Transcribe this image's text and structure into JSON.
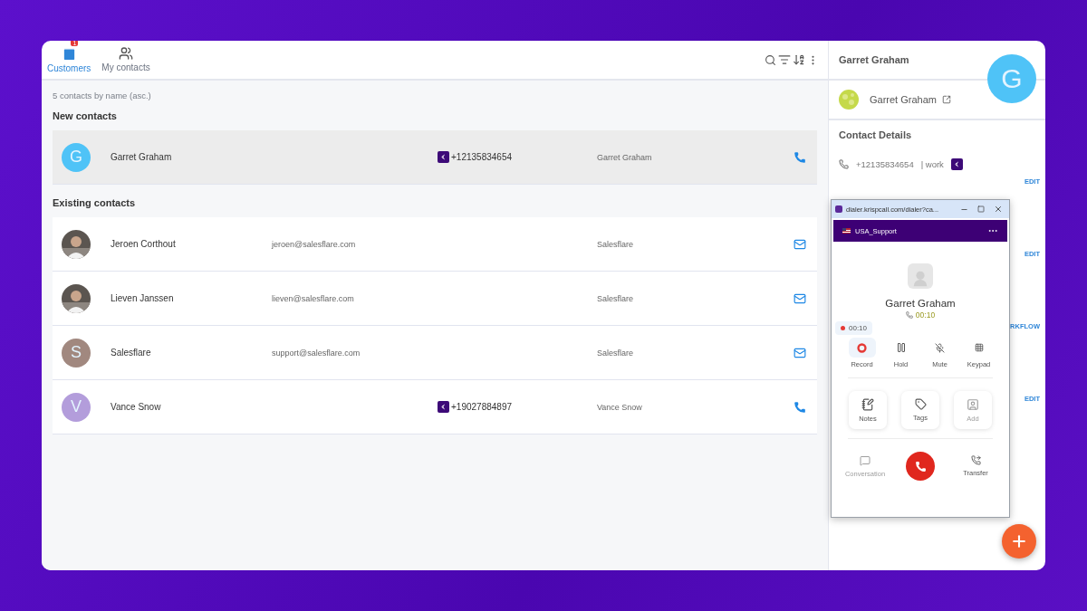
{
  "tabs": [
    {
      "label": "Customers",
      "selected": true,
      "badge": "1"
    },
    {
      "label": "My contacts",
      "selected": false
    }
  ],
  "list": {
    "summary": "5 contacts by name (asc.)",
    "sections": [
      {
        "title": "New contacts",
        "contacts": [
          {
            "name": "Garret Graham",
            "avatar": {
              "kind": "letter",
              "letter": "G",
              "color": "#4fc3f7"
            },
            "phone": "+12135834654",
            "company": "Garret Graham",
            "kind": "call",
            "selected": true
          }
        ]
      },
      {
        "title": "Existing contacts",
        "contacts": [
          {
            "name": "Jeroen Corthout",
            "email": "jeroen@salesflare.com",
            "company": "Salesflare",
            "kind": "email",
            "selected": false
          },
          {
            "name": "Lieven Janssen",
            "email": "lieven@salesflare.com",
            "company": "Salesflare",
            "kind": "email",
            "selected": false
          },
          {
            "name": "Salesflare",
            "avatar": {
              "kind": "letter",
              "letter": "S",
              "color": "#a1887f"
            },
            "email": "support@salesflare.com",
            "company": "Salesflare",
            "kind": "email",
            "selected": false
          },
          {
            "name": "Vance Snow",
            "avatar": {
              "kind": "letter",
              "letter": "V",
              "color": "#b39ddb"
            },
            "phone": "+19027884897",
            "company": "Vance Snow",
            "kind": "call",
            "selected": false
          }
        ]
      }
    ]
  },
  "detail": {
    "title": "Garret Graham",
    "avatar_letter": "G",
    "name": "Garret Graham",
    "section_title": "Contact Details",
    "phone": "+12135834654",
    "phone_label": "| work",
    "links": [
      "EDIT",
      "EDIT",
      "RKFLOW",
      "EDIT"
    ]
  },
  "dialer": {
    "url": "dialer.krispcall.com/dialer?ca...",
    "line": "USA_Support",
    "name": "Garret Graham",
    "call_time": "00:10",
    "recording_time": "00:10",
    "controls": [
      {
        "kind": "record",
        "label": "Record",
        "active": true
      },
      {
        "kind": "hold",
        "label": "Hold",
        "active": false
      },
      {
        "kind": "mute",
        "label": "Mute",
        "active": false
      },
      {
        "kind": "keypad",
        "label": "Keypad",
        "active": false
      }
    ],
    "tools": [
      {
        "kind": "notes",
        "label": "Notes",
        "disabled": false
      },
      {
        "kind": "tags",
        "label": "Tags",
        "disabled": false
      },
      {
        "kind": "add",
        "label": "Add",
        "disabled": true
      }
    ],
    "footer": [
      {
        "kind": "conversation",
        "label": "Conversation",
        "disabled": true
      },
      {
        "kind": "transfer",
        "label": "Transfer",
        "disabled": false
      }
    ]
  }
}
